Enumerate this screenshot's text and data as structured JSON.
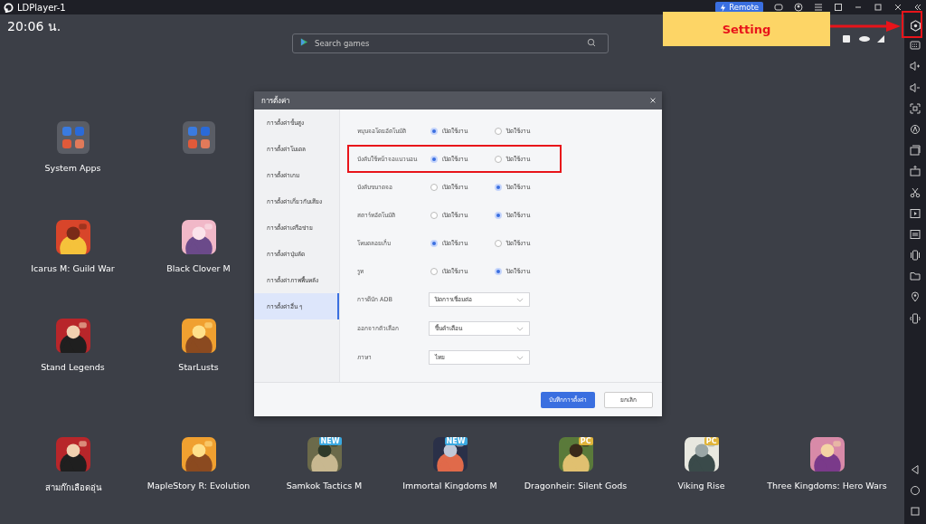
{
  "window": {
    "title": "LDPlayer-1",
    "remote_button": "Remote"
  },
  "status_bar": {
    "time": "20:06 น."
  },
  "search": {
    "placeholder": "Search games"
  },
  "annotation": {
    "label": "Setting"
  },
  "desktop_apps": [
    {
      "kind": "folder",
      "label": "System Apps"
    },
    {
      "kind": "folder"
    },
    {
      "kind": "picture",
      "label": "Icarus M: Guild War"
    },
    {
      "kind": "picture",
      "label": "Black Clover M"
    },
    {
      "kind": "picture",
      "label": "Stand Legends"
    },
    {
      "kind": "picture",
      "label": "StarLusts"
    }
  ],
  "dock_apps": [
    {
      "kind": "picture",
      "label": "สามก๊กเลือดอุ่น"
    },
    {
      "kind": "picture",
      "label": "MapleStory R: Evolution"
    },
    {
      "kind": "picture",
      "label": "Samkok Tactics M",
      "badge": "NEW"
    },
    {
      "kind": "picture",
      "label": "Immortal Kingdoms M",
      "badge": "NEW"
    },
    {
      "kind": "picture",
      "label": "Dragonheir: Silent Gods",
      "badge": "PC"
    },
    {
      "kind": "picture",
      "label": "Viking Rise",
      "badge": "PC"
    },
    {
      "kind": "picture",
      "label": "Three Kingdoms: Hero Wars"
    }
  ],
  "dialog": {
    "title": "การตั้งค่า",
    "sidebar": [
      {
        "label": "การตั้งค่าขั้นสูง",
        "selected": false
      },
      {
        "label": "การตั้งค่าโมเดล",
        "selected": false
      },
      {
        "label": "การตั้งค่าเกม",
        "selected": false
      },
      {
        "label": "การตั้งค่าเกี่ยวกับเสียง",
        "selected": false
      },
      {
        "label": "การตั้งค่าเครือข่าย",
        "selected": false
      },
      {
        "label": "การตั้งค่าปุ่มลัด",
        "selected": false
      },
      {
        "label": "การตั้งค่าภาพพื้นหลัง",
        "selected": false
      },
      {
        "label": "การตั้งค่าอื่น ๆ",
        "selected": true
      }
    ],
    "options": [
      {
        "label": "หมุนจอโดยอัตโนมัติ",
        "highlighted": false,
        "choices": [
          {
            "label": "เปิดใช้งาน",
            "selected": true
          },
          {
            "label": "ปิดใช้งาน",
            "selected": false
          }
        ]
      },
      {
        "label": "บังคับใช้หน้าจอแนวนอน",
        "highlighted": true,
        "choices": [
          {
            "label": "เปิดใช้งาน",
            "selected": true
          },
          {
            "label": "ปิดใช้งาน",
            "selected": false
          }
        ]
      },
      {
        "label": "บังคับขนาดจอ",
        "highlighted": false,
        "choices": [
          {
            "label": "เปิดใช้งาน",
            "selected": false
          },
          {
            "label": "ปิดใช้งาน",
            "selected": true
          }
        ]
      },
      {
        "label": "สตาร์ทอัตโนมัติ",
        "highlighted": false,
        "choices": [
          {
            "label": "เปิดใช้งาน",
            "selected": false
          },
          {
            "label": "ปิดใช้งาน",
            "selected": true
          }
        ]
      },
      {
        "label": "โหมดลอยเก็บ",
        "highlighted": false,
        "choices": [
          {
            "label": "เปิดใช้งาน",
            "selected": true
          },
          {
            "label": "ปิดใช้งาน",
            "selected": false
          }
        ]
      },
      {
        "label": "รูท",
        "highlighted": false,
        "choices": [
          {
            "label": "เปิดใช้งาน",
            "selected": false
          },
          {
            "label": "ปิดใช้งาน",
            "selected": true
          }
        ]
      }
    ],
    "selects": [
      {
        "label": "การดีบัก ADB",
        "value": "ปิดการเชื่อมต่อ"
      },
      {
        "label": "ออกจากตัวเลือก",
        "value": "ขึ้นคำเตือน"
      },
      {
        "label": "ภาษา",
        "value": "ไทย"
      }
    ],
    "save_button": "บันทึกการตั้งค่า",
    "cancel_button": "ยกเลิก"
  }
}
